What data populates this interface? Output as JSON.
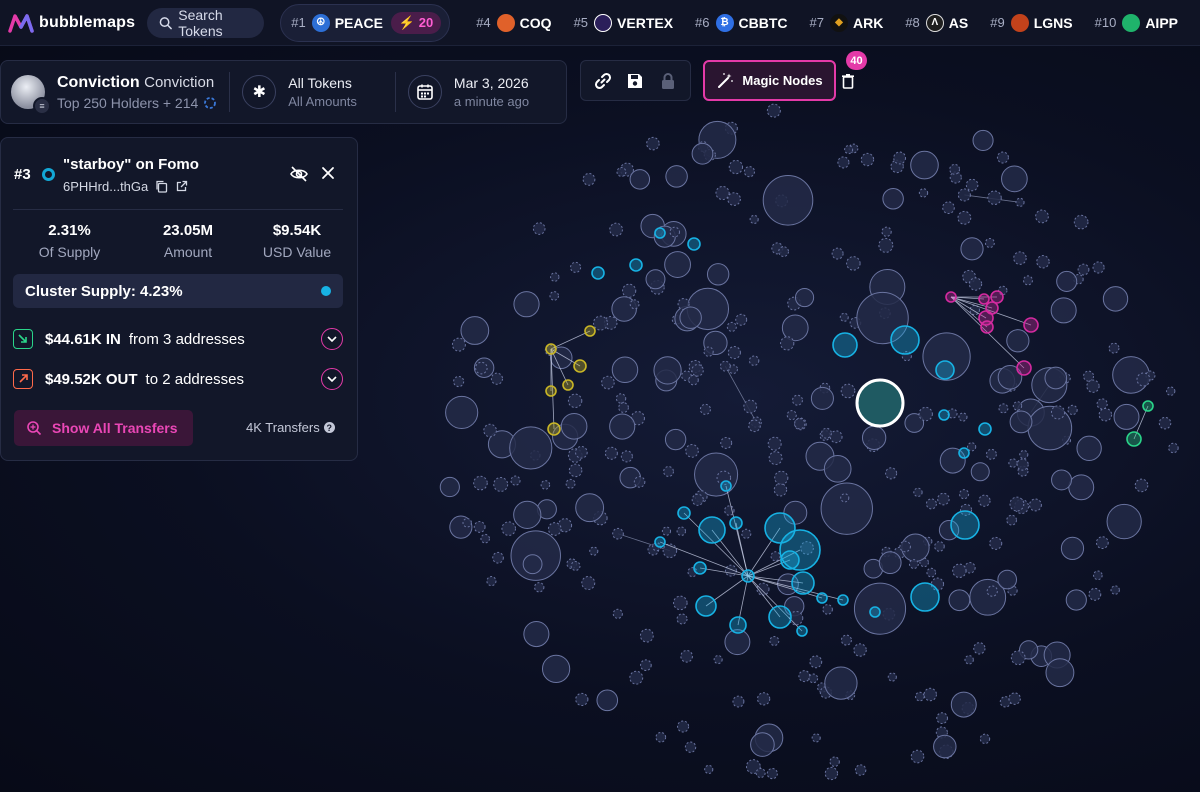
{
  "app": {
    "name": "bubblemaps"
  },
  "search": {
    "label": "Search Tokens"
  },
  "trending_active": {
    "rank": "#1",
    "symbol": "PEACE",
    "boost": "20"
  },
  "trending": [
    {
      "rank": "#4",
      "symbol": "COQ",
      "color": "#e0612a"
    },
    {
      "rank": "#5",
      "symbol": "VERTEX",
      "color": "#2b1f5a"
    },
    {
      "rank": "#6",
      "symbol": "CBBTC",
      "color": "#2f6fe4"
    },
    {
      "rank": "#7",
      "symbol": "ARK",
      "color": "#111111"
    },
    {
      "rank": "#8",
      "symbol": "AS",
      "color": "#1f1f1f"
    },
    {
      "rank": "#9",
      "symbol": "LGNS",
      "color": "#c2421b"
    },
    {
      "rank": "#10",
      "symbol": "AIPP",
      "color": "#1fb36b"
    }
  ],
  "token": {
    "name": "Conviction",
    "symbol": "Conviction",
    "holders_label": "Top 250 Holders + 214"
  },
  "filters": {
    "tokens": "All Tokens",
    "amounts": "All Amounts"
  },
  "date": {
    "value": "Mar 3, 2026",
    "relative": "a minute ago"
  },
  "magic_nodes": {
    "label": "Magic Nodes",
    "count": "40"
  },
  "panel": {
    "rank": "#3",
    "name": "\"starboy\" on Fomo",
    "address": "6PHHrd...thGa",
    "stats": [
      {
        "value": "2.31%",
        "label": "Of Supply"
      },
      {
        "value": "23.05M",
        "label": "Amount"
      },
      {
        "value": "$9.54K",
        "label": "USD Value"
      }
    ],
    "cluster_supply": "Cluster Supply: 4.23%",
    "in": {
      "amount": "$44.61K IN",
      "text": "from 3 addresses"
    },
    "out": {
      "amount": "$49.52K OUT",
      "text": "to 2 addresses"
    },
    "show_all": "Show All Transfers",
    "transfers": "4K Transfers"
  },
  "colors": {
    "accent": "#e43aa8",
    "cyan_cluster": "#17b2e4",
    "magenta_cluster": "#d42aa0",
    "yellow_cluster": "#c9b626",
    "green_cluster": "#2ad58a",
    "bubble": "#2a3150"
  }
}
